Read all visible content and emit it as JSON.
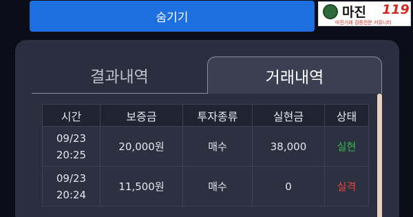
{
  "hide_button": {
    "label": "숨기기"
  },
  "logo": {
    "brand_text": "마진",
    "brand_number": "119",
    "tagline": "마진거래 검증전문 커뮤니티"
  },
  "tabs": [
    {
      "label": "결과내역",
      "active": false
    },
    {
      "label": "거래내역",
      "active": true
    }
  ],
  "table": {
    "headers": [
      "시간",
      "보증금",
      "투자종류",
      "실현금",
      "상태"
    ],
    "rows": [
      {
        "date": "09/23",
        "time": "20:25",
        "deposit": "20,000원",
        "type": "매수",
        "realized": "38,000",
        "status": "실현",
        "status_color": "#3ab54a"
      },
      {
        "date": "09/23",
        "time": "20:24",
        "deposit": "11,500원",
        "type": "매수",
        "realized": "0",
        "status": "실격",
        "status_color": "#e8453c"
      }
    ]
  },
  "colors": {
    "accent": "#1d6fe0",
    "panel": "#2a2f40",
    "success": "#3ab54a",
    "fail": "#e8453c"
  }
}
